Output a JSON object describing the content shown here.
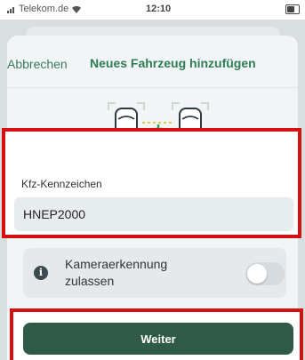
{
  "status_bar": {
    "carrier": "Telekom.de",
    "time": "12:10"
  },
  "header": {
    "cancel_label": "Abbrechen",
    "title": "Neues Fahrzeug hinzufügen"
  },
  "illustration": {
    "icon": "two-cars-icon",
    "accent_color": "#2e9e5e"
  },
  "license_plate": {
    "label": "Kfz-Kennzeichen",
    "value": "HNEP2000"
  },
  "camera_toggle": {
    "label": "Kameraerkennung zulassen",
    "enabled": false
  },
  "actions": {
    "continue_label": "Weiter"
  },
  "colors": {
    "primary": "#2f5a47",
    "highlight": "#d51010"
  }
}
